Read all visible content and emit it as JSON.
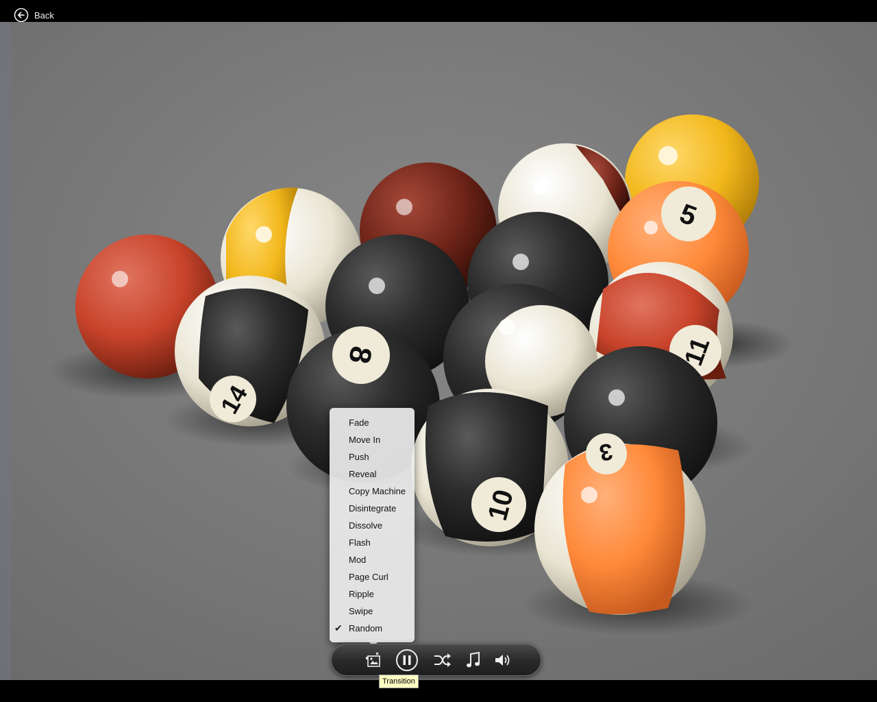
{
  "topbar": {
    "back_label": "Back"
  },
  "photo": {
    "ball_numbers": [
      "5",
      "11",
      "14",
      "8",
      "10",
      "3"
    ]
  },
  "transition_menu": {
    "items": [
      {
        "label": "Fade",
        "checked": false
      },
      {
        "label": "Move In",
        "checked": false
      },
      {
        "label": "Push",
        "checked": false
      },
      {
        "label": "Reveal",
        "checked": false
      },
      {
        "label": "Copy Machine",
        "checked": false
      },
      {
        "label": "Disintegrate",
        "checked": false
      },
      {
        "label": "Dissolve",
        "checked": false
      },
      {
        "label": "Flash",
        "checked": false
      },
      {
        "label": "Mod",
        "checked": false
      },
      {
        "label": "Page Curl",
        "checked": false
      },
      {
        "label": "Ripple",
        "checked": false
      },
      {
        "label": "Swipe",
        "checked": false
      },
      {
        "label": "Random",
        "checked": true
      }
    ],
    "check_mark": "✔"
  },
  "controls": {
    "buttons": [
      "transition-icon",
      "pause-icon",
      "shuffle-icon",
      "music-icon",
      "volume-icon"
    ],
    "tooltip": "Transition"
  },
  "colors": {
    "felt": "#7c7c7c",
    "orange": "#ff8a3a",
    "yellow": "#f2b81c",
    "red": "#c8432a",
    "maroon": "#6e2418",
    "cream": "#e9e4d2",
    "black_ball": "#2a2a2a"
  }
}
